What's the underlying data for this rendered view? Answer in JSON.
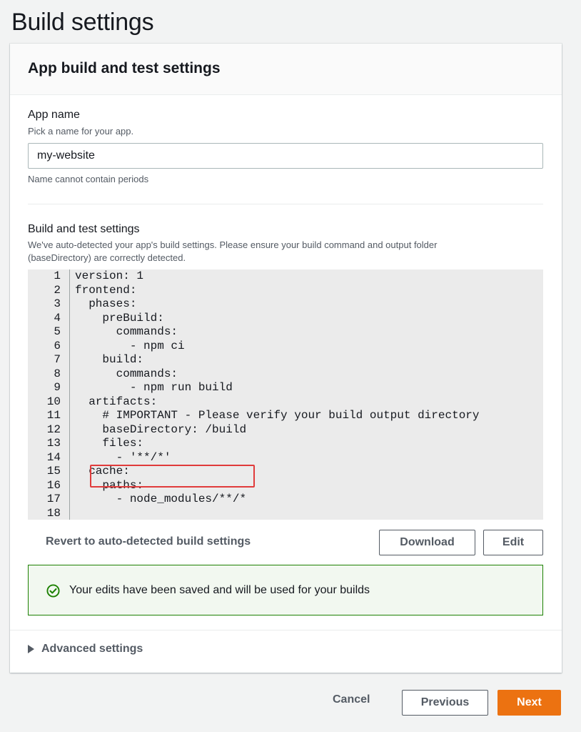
{
  "page": {
    "title": "Build settings"
  },
  "panel": {
    "title": "App build and test settings",
    "app_name": {
      "label": "App name",
      "description": "Pick a name for your app.",
      "value": "my-website",
      "constraint": "Name cannot contain periods"
    },
    "build_settings": {
      "label": "Build and test settings",
      "description_line1": "We've auto-detected your app's build settings. Please ensure your build command and output folder",
      "description_line2": "(baseDirectory) are correctly detected.",
      "code_lines": [
        "version: 1",
        "frontend:",
        "  phases:",
        "    preBuild:",
        "      commands:",
        "        - npm ci",
        "    build:",
        "      commands:",
        "        - npm run build",
        "  artifacts:",
        "    # IMPORTANT - Please verify your build output directory",
        "    baseDirectory: /build",
        "    files:",
        "      - '**/*'",
        "  cache:",
        "    paths:",
        "      - node_modules/**/*",
        ""
      ],
      "line_numbers": [
        "1",
        "2",
        "3",
        "4",
        "5",
        "6",
        "7",
        "8",
        "9",
        "10",
        "11",
        "12",
        "13",
        "14",
        "15",
        "16",
        "17",
        "18"
      ],
      "revert_label": "Revert to auto-detected build settings",
      "download_label": "Download",
      "edit_label": "Edit"
    },
    "alert": {
      "icon": "check-circle-icon",
      "text": "Your edits have been saved and will be used for your builds",
      "color": "#1d8102"
    },
    "advanced": {
      "label": "Advanced settings"
    }
  },
  "footer": {
    "cancel_label": "Cancel",
    "previous_label": "Previous",
    "next_label": "Next",
    "accent": "#ec7211"
  }
}
